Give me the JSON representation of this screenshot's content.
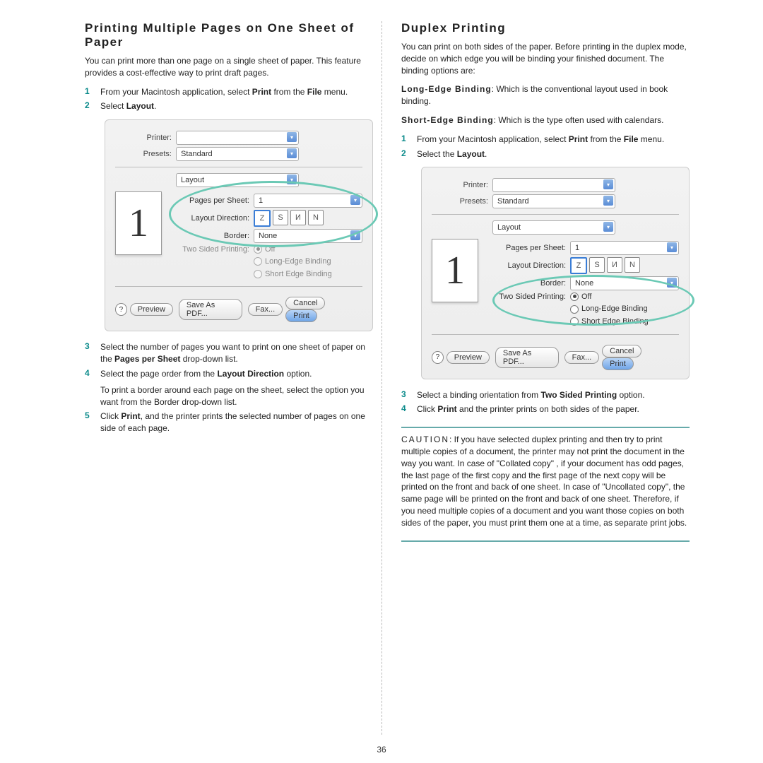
{
  "left": {
    "heading": "Printing Multiple Pages on One Sheet of Paper",
    "intro": "You can print more than one page on a single sheet of paper. This feature provides a cost-effective way to print draft pages.",
    "step1": "From your Macintosh application, select Print from the File menu.",
    "step2": "Select Layout.",
    "step3_a": "Select the number of pages you want to print on one sheet of paper on the ",
    "step3_b": "Pages per Sheet",
    "step3_c": " drop-down list.",
    "step4_a": "Select the page order from the ",
    "step4_b": "Layout Direction",
    "step4_c": " option.",
    "step4_extra": "To print a border around each page on the sheet, select the option you want from the Border drop-down list.",
    "step5_a": "Click ",
    "step5_b": "Print",
    "step5_c": ", and the printer prints the selected number of pages on one side of each page."
  },
  "right": {
    "heading": "Duplex Printing",
    "intro": "You can print on both sides of the paper. Before printing in the duplex mode, decide on which edge you will be binding your finished document. The binding options are:",
    "long_label": "Long-Edge Binding",
    "long_text": ": Which is the conventional layout used in book binding.",
    "short_label": "Short-Edge Binding",
    "short_text": ": Which is the type often used with calendars.",
    "step1": "From your Macintosh application, select Print from the File menu.",
    "step2_a": "Select the ",
    "step2_b": "Layout",
    "step2_c": ".",
    "step3_a": "Select a binding orientation from ",
    "step3_b": "Two Sided Printing",
    "step3_c": " option.",
    "step4_a": "Click ",
    "step4_b": "Print",
    "step4_c": " and the printer prints on both sides of the paper.",
    "caution_label": "CAUTION",
    "caution": ": If you have selected duplex printing and then try to print multiple copies of a document, the printer may not print the document in the way you want. In case of  \"Collated copy\" , if your document has odd pages, the last page of the first copy and the first page of the next copy will be printed on the front and back of one sheet. In case of  \"Uncollated copy\", the same page will be printed on the front and back of one sheet. Therefore, if you need multiple copies of a document and you want those copies on both sides of the paper, you must print them one at a time, as separate print jobs."
  },
  "dialog": {
    "printer": "Printer:",
    "presets": "Presets:",
    "presets_val": "Standard",
    "layout": "Layout",
    "pps": "Pages per Sheet:",
    "pps_val": "1",
    "dir": "Layout Direction:",
    "border": "Border:",
    "border_val": "None",
    "tsp": "Two Sided Printing:",
    "off": "Off",
    "lbinding": "Long-Edge Binding",
    "sbinding": "Short Edge Binding",
    "preview": "Preview",
    "savepdf": "Save As PDF...",
    "fax": "Fax...",
    "cancel": "Cancel",
    "print": "Print",
    "help": "?",
    "previewnum": "1"
  },
  "pagenum": "36"
}
